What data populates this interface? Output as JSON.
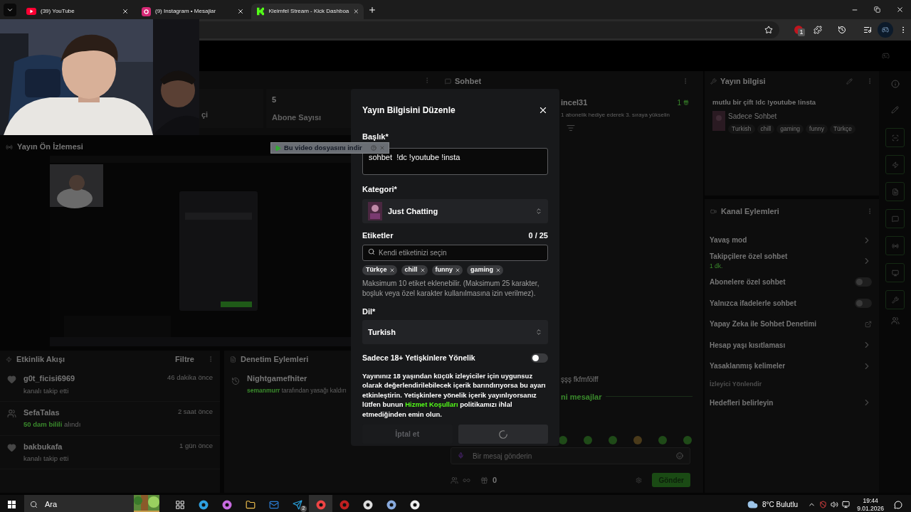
{
  "browser": {
    "tabs": [
      {
        "title": "(39) YouTube",
        "kind": "youtube",
        "selected": false
      },
      {
        "title": "(9) Instagram • Mesajlar",
        "kind": "instagram",
        "selected": false
      },
      {
        "title": "Kleimfel Stream - Kick Dashboa",
        "kind": "kick",
        "selected": true
      }
    ],
    "extension_badge": "1"
  },
  "download_bar": {
    "label": "Bu video dosyasını indir"
  },
  "dashboard": {
    "stats": [
      {
        "label": "çi"
      },
      {
        "value": "5",
        "label": "Abone Sayısı"
      }
    ],
    "preview": {
      "title": "Yayın Ön İzlemesi"
    },
    "activity": {
      "title": "Etkinlik Akışı",
      "filter": "Filtre",
      "items": [
        {
          "kind": "follow",
          "name": "g0t_ficisi6969",
          "detail": "kanalı takip etti",
          "time": "46 dakika önce"
        },
        {
          "kind": "gift",
          "name": "SefaTalas",
          "highlight": "50 dam bilili",
          "detail": "alındı",
          "time": "2 saat önce"
        },
        {
          "kind": "follow",
          "name": "bakbukafa",
          "detail": "kanalı takip etti",
          "time": "1 gün önce"
        }
      ]
    },
    "moderation": {
      "title": "Denetim Eylemleri",
      "items": [
        {
          "name": "Nightgamefhiter",
          "highlight": "semanmurr",
          "detail": "tarafından yasağı kaldırı"
        }
      ]
    },
    "chat": {
      "title": "Sohbet",
      "gift": {
        "name": "incel31",
        "count": "1",
        "text": "1 abonelik hediye ederek 3. sıraya yükselin"
      },
      "message": "şşş fkfmfölff",
      "new_messages": "ni mesajlar",
      "input_placeholder": "Bir mesaj gönderin",
      "count": "0",
      "send": "Gönder"
    },
    "stream_info": {
      "title": "Yayın bilgisi",
      "stream_title": "mutlu bir çift !dc !youtube !insta",
      "category": "Sadece Sohbet",
      "tags": [
        "Turkish",
        "chill",
        "gaming",
        "funny",
        "Türkçe"
      ]
    },
    "channel_actions": {
      "title": "Kanal Eylemleri",
      "items": [
        {
          "kind": "chevron",
          "label": "Yavaş mod"
        },
        {
          "kind": "chevron",
          "label": "Takipçilere özel sohbet",
          "sub": "1 dk."
        },
        {
          "kind": "toggle",
          "label": "Abonelere özel sohbet",
          "on": false
        },
        {
          "kind": "toggle",
          "label": "Yalnızca ifadelerle sohbet",
          "on": false
        },
        {
          "kind": "external",
          "label": "Yapay Zeka ile Sohbet Denetimi"
        },
        {
          "kind": "chevron",
          "label": "Hesap yaşı kısıtlaması"
        },
        {
          "kind": "chevron",
          "label": "Yasaklanmış kelimeler"
        },
        {
          "kind": "disabled",
          "label": "İzleyici Yönlendir"
        },
        {
          "kind": "chevron",
          "label": "Hedefleri belirleyin"
        }
      ]
    }
  },
  "modal": {
    "title": "Yayın Bilgisini Düzenle",
    "title_label": "Başlık*",
    "title_value": "sohbet  !dc !youtube !insta",
    "category_label": "Kategori*",
    "category": "Just Chatting",
    "tags_label": "Etiketler",
    "tags_count": "0 / 25",
    "tag_placeholder": "Kendi etiketinizi seçin",
    "tags": [
      "Türkçe",
      "chill",
      "funny",
      "gaming"
    ],
    "tags_help": "Maksimum 10 etiket eklenebilir. (Maksimum 25 karakter, boşluk veya özel karakter kullanılmasına izin verilmez).",
    "language_label": "Dil*",
    "language": "Turkish",
    "mature_label": "Sadece 18+ Yetişkinlere Yönelik",
    "mature": false,
    "mature_help_before": "Yayınınız 18 yaşından küçük izleyiciler için uygunsuz olarak değerlendirilebilecek içerik barındırıyorsa bu ayarı etkinleştirin. Yetişkinlere yönelik içerik yayınlıyorsanız lütfen bunun",
    "terms_link": "Hizmet Koşulları",
    "mature_help_after": "politikamızı ihlal etmediğinden emin olun.",
    "cancel": "İptal et",
    "saving": true
  },
  "taskbar": {
    "search": "Ara",
    "telegram_badge": "2",
    "weather": "8°C Bulutlu",
    "time": "19:44",
    "date": "9.01.2026"
  }
}
